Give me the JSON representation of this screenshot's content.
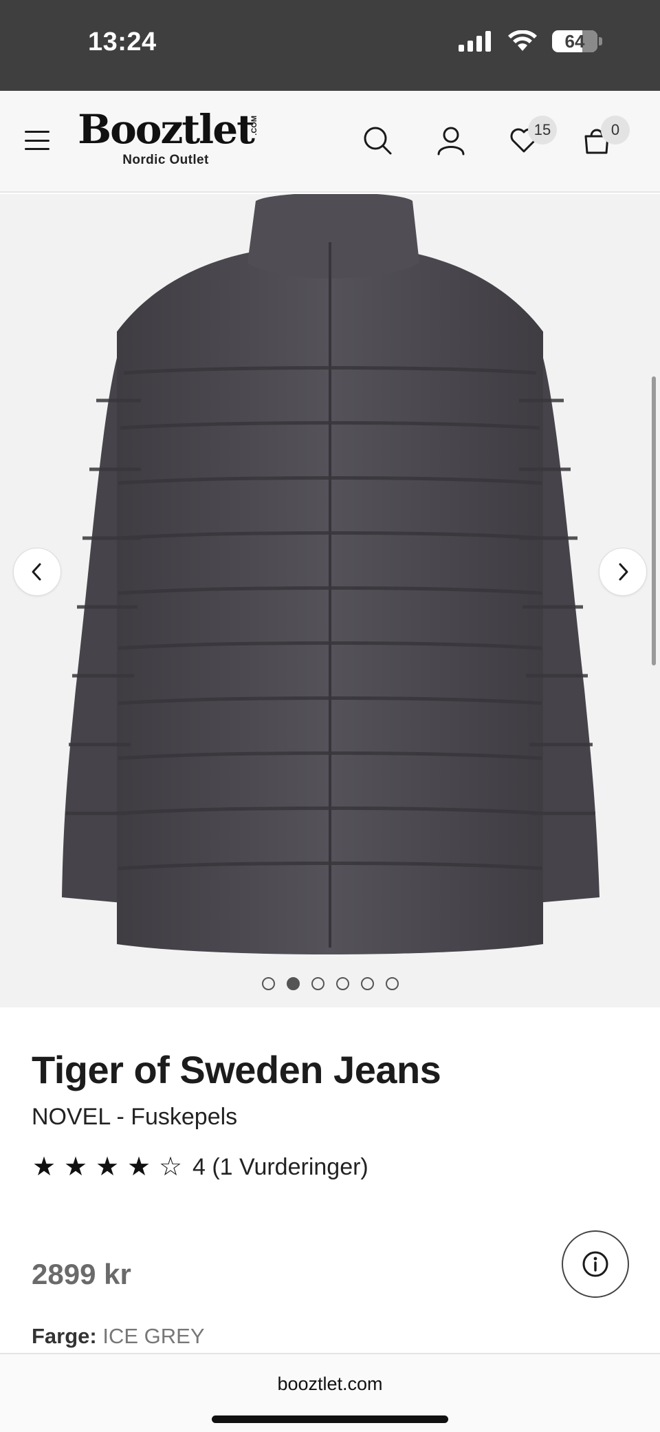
{
  "status_bar": {
    "time": "13:24",
    "battery": "64"
  },
  "header": {
    "logo": "Booztlet",
    "logo_suffix": ".COM",
    "logo_subtitle": "Nordic Outlet",
    "wishlist_count": "15",
    "cart_count": "0"
  },
  "gallery": {
    "image_count": 6,
    "active_index": 1,
    "product_color": "#4a474d"
  },
  "product": {
    "brand": "Tiger of Sweden Jeans",
    "name": "NOVEL - Fuskepels",
    "rating_value": 4,
    "rating_text": "4 (1 Vurderinger)",
    "price": "2899 kr",
    "color_label": "Farge:",
    "color_value": "ICE GREY"
  },
  "browser": {
    "url": "booztlet.com"
  }
}
